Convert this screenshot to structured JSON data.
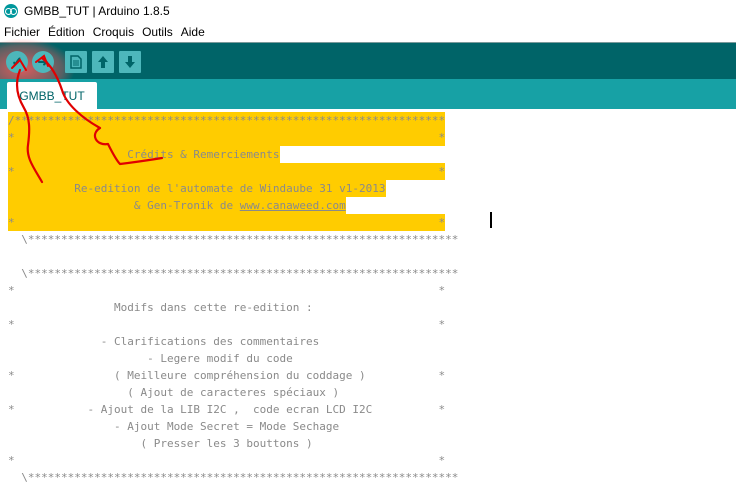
{
  "window": {
    "title": "GMBB_TUT | Arduino 1.8.5"
  },
  "menu": {
    "items": [
      "Fichier",
      "Édition",
      "Croquis",
      "Outils",
      "Aide"
    ]
  },
  "toolbar": {
    "verify_icon": "checkmark-icon",
    "upload_icon": "arrow-right-icon",
    "new_icon": "document-icon",
    "open_icon": "arrow-up-icon",
    "save_icon": "arrow-down-icon"
  },
  "tabs": [
    {
      "label": "GMBB_TUT"
    }
  ],
  "colors": {
    "toolbar": "#006468",
    "tabstrip": "#17a1a5",
    "highlight": "#ffcc00",
    "annotation": "#e00000"
  },
  "code": {
    "lines": [
      "/*****************************************************************",
      "*                                                                *",
      "                  Crédits & Remerciements",
      "*                                                                *",
      "          Re-edition de l'automate de Windaube 31 v1-2013",
      "                   & Gen-Tronik de ",
      "*                                                                *",
      "  \\*****************************************************************",
      "",
      "  \\*****************************************************************",
      "*                                                                *",
      "",
      "                Modifs dans cette re-edition :",
      "*                                                                *",
      "",
      "              - Clarifications des commentaires",
      "                     - Legere modif du code",
      "*               ( Meilleure compréhension du coddage )           *",
      "                  ( Ajout de caracteres spéciaux )",
      "*           - Ajout de la LIB I2C ,  code ecran LCD I2C          *",
      "                - Ajout Mode Secret = Mode Sechage",
      "                    ( Presser les 3 bouttons )",
      "*                                                                *",
      "  \\*****************************************************************"
    ],
    "link": "www.canaweed.com"
  }
}
